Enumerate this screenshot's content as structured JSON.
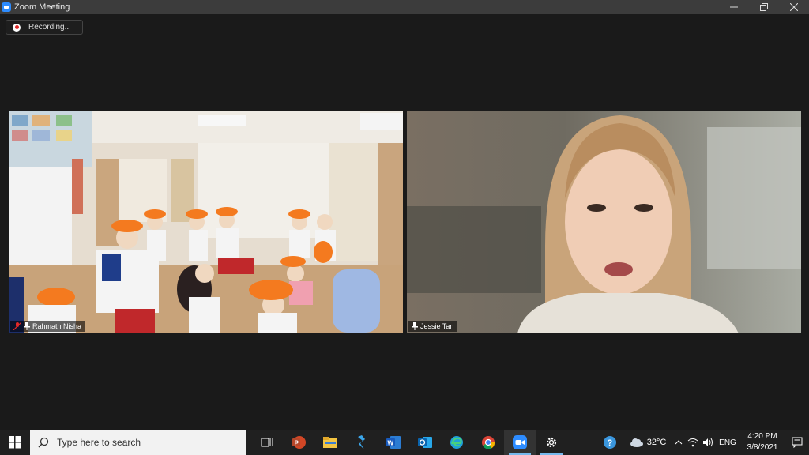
{
  "window": {
    "title": "Zoom Meeting"
  },
  "recording": {
    "label": "Recording..."
  },
  "participants": [
    {
      "name": "Rahmath Nisha",
      "muted": true
    },
    {
      "name": "Jessie Tan",
      "muted": false
    }
  ],
  "taskbar": {
    "search_placeholder": "Type here to search",
    "weather": "32°C",
    "language": "ENG",
    "time": "4:20 PM",
    "date": "3/8/2021",
    "apps": [
      "task-view-icon",
      "powerpoint-icon",
      "file-explorer-icon",
      "visual-studio-icon",
      "word-icon",
      "outlook-icon",
      "edge-icon",
      "chrome-icon",
      "zoom-icon",
      "settings-icon",
      "help-icon"
    ]
  },
  "colors": {
    "zoom_blue": "#2d8cff",
    "recording_red": "#e02828",
    "taskbar": "#202020"
  }
}
